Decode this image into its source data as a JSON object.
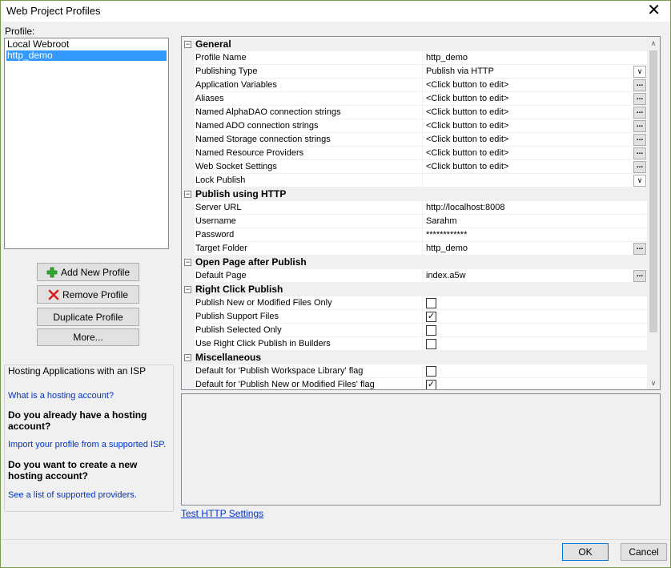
{
  "window": {
    "title": "Web Project Profiles"
  },
  "profile": {
    "label": "Profile:",
    "items": [
      {
        "label": "Local Webroot",
        "selected": false
      },
      {
        "label": "http_demo",
        "selected": true
      }
    ]
  },
  "buttons": {
    "add": "Add New Profile",
    "remove": "Remove Profile",
    "duplicate": "Duplicate Profile",
    "more": "More..."
  },
  "hosting": {
    "header": "Hosting Applications with an ISP",
    "what_link": "What is a hosting account?",
    "q1": "Do you already have a hosting account?",
    "import_link": "Import your profile from a supported ISP.",
    "q2": "Do you want to create a new hosting account?",
    "providers_link": "See a list of supported providers."
  },
  "grid": {
    "rows": [
      {
        "kind": "category",
        "label": "General"
      },
      {
        "kind": "prop",
        "name": "Profile Name",
        "value": "http_demo",
        "control": "none"
      },
      {
        "kind": "prop",
        "name": "Publishing Type",
        "value": "Publish via HTTP",
        "control": "dropdown"
      },
      {
        "kind": "prop",
        "name": "Application Variables",
        "value": "<Click button to edit>",
        "control": "ellipsis"
      },
      {
        "kind": "prop",
        "name": "Aliases",
        "value": "<Click button to edit>",
        "control": "ellipsis"
      },
      {
        "kind": "prop",
        "name": "Named AlphaDAO connection strings",
        "value": "<Click button to edit>",
        "control": "ellipsis"
      },
      {
        "kind": "prop",
        "name": "Named ADO connection strings",
        "value": "<Click button to edit>",
        "control": "ellipsis"
      },
      {
        "kind": "prop",
        "name": "Named Storage connection strings",
        "value": "<Click button to edit>",
        "control": "ellipsis"
      },
      {
        "kind": "prop",
        "name": "Named Resource Providers",
        "value": "<Click button to edit>",
        "control": "ellipsis"
      },
      {
        "kind": "prop",
        "name": "Web Socket Settings",
        "value": "<Click button to edit>",
        "control": "ellipsis"
      },
      {
        "kind": "prop",
        "name": "Lock Publish",
        "value": "",
        "control": "dropdown"
      },
      {
        "kind": "category",
        "label": "Publish using HTTP"
      },
      {
        "kind": "prop",
        "name": "Server URL",
        "value": "http://localhost:8008",
        "control": "none"
      },
      {
        "kind": "prop",
        "name": "Username",
        "value": "Sarahm",
        "control": "none"
      },
      {
        "kind": "prop",
        "name": "Password",
        "value": "************",
        "control": "none"
      },
      {
        "kind": "prop",
        "name": "Target Folder",
        "value": "http_demo",
        "control": "ellipsis"
      },
      {
        "kind": "category",
        "label": "Open Page after Publish"
      },
      {
        "kind": "prop",
        "name": "Default Page",
        "value": "index.a5w",
        "control": "ellipsis"
      },
      {
        "kind": "category",
        "label": "Right Click Publish"
      },
      {
        "kind": "prop",
        "name": "Publish New or Modified Files Only",
        "checked": false,
        "control": "checkbox"
      },
      {
        "kind": "prop",
        "name": "Publish Support Files",
        "checked": true,
        "control": "checkbox"
      },
      {
        "kind": "prop",
        "name": "Publish Selected Only",
        "checked": false,
        "control": "checkbox"
      },
      {
        "kind": "prop",
        "name": "Use Right Click Publish in Builders",
        "checked": false,
        "control": "checkbox"
      },
      {
        "kind": "category",
        "label": "Miscellaneous"
      },
      {
        "kind": "prop",
        "name": "Default for 'Publish Workspace Library' flag",
        "checked": false,
        "control": "checkbox"
      },
      {
        "kind": "prop",
        "name": "Default for 'Publish New or Modified Files' flag",
        "checked": true,
        "control": "checkbox"
      }
    ]
  },
  "icons": {
    "ellipsis": "...",
    "dropdown": "∨",
    "check": "✓",
    "toggle": "−",
    "close": "✕",
    "scroll_up": "∧",
    "scroll_down": "∨"
  },
  "test_link": "Test HTTP Settings",
  "footer": {
    "ok": "OK",
    "cancel": "Cancel"
  },
  "colors": {
    "selection": "#3399ff",
    "link": "#0033cc",
    "add_icon": "#2eaa2e",
    "remove_icon": "#d42020"
  }
}
